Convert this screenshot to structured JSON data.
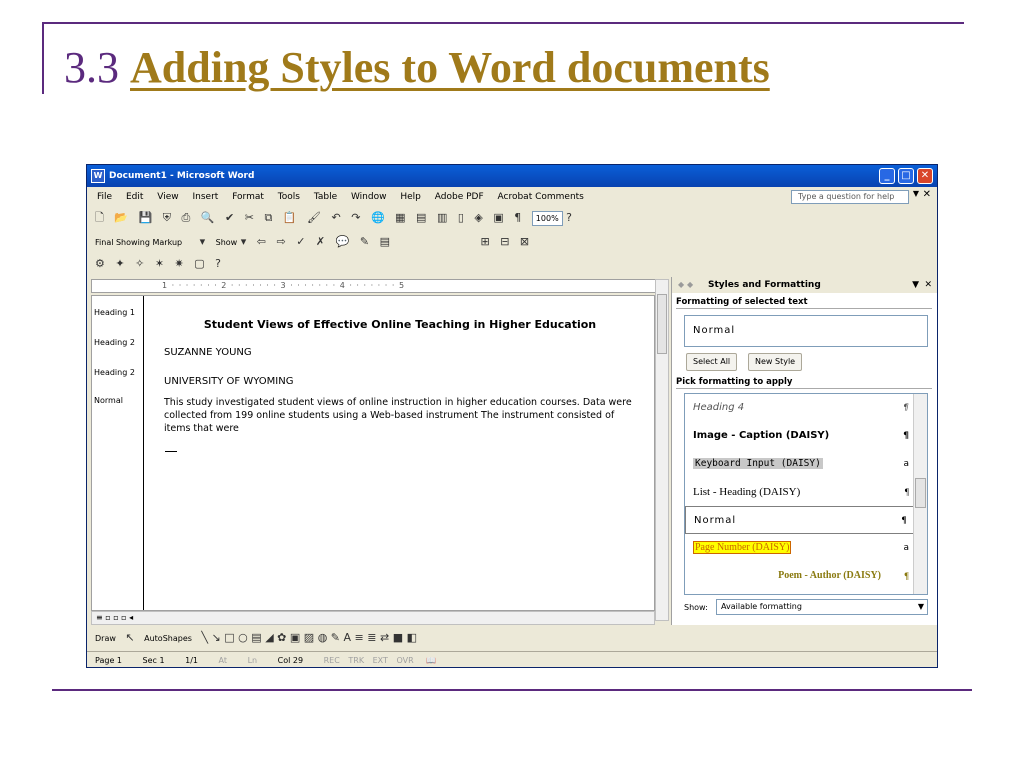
{
  "slide": {
    "title_number": "3.3",
    "title_text": "Adding Styles to Word documents"
  },
  "window": {
    "title": "Document1 - Microsoft Word",
    "minimize": "_",
    "maximize": "□",
    "close": "✕"
  },
  "menu": {
    "items": [
      "File",
      "Edit",
      "View",
      "Insert",
      "Format",
      "Tools",
      "Table",
      "Window",
      "Help",
      "Adobe PDF",
      "Acrobat Comments"
    ],
    "ask_placeholder": "Type a question for help",
    "close": "✕"
  },
  "toolbar1": {
    "zoom": "100%"
  },
  "toolbar2": {
    "markup": "Final Showing Markup",
    "show": "Show"
  },
  "ruler": {
    "text": "1 · · · · · · · 2 · · · · · · · 3 · · · · · · · 4 · · · · · · · 5"
  },
  "document": {
    "style_labels": [
      "Heading 1",
      "Heading 2",
      "Heading 2",
      "Normal"
    ],
    "title": "Student Views of Effective Online Teaching in Higher Education",
    "author": "SUZANNE YOUNG",
    "affiliation": "UNIVERSITY OF WYOMING",
    "paragraph": "This study investigated student views of online instruction in higher education courses. Data were collected from 199 online students using a Web-based instrument The instrument consisted of items that were"
  },
  "drawbar": {
    "draw": "Draw",
    "autoshapes": "AutoShapes"
  },
  "status": {
    "page": "Page 1",
    "sec": "Sec 1",
    "pages": "1/1",
    "at": "At",
    "ln": "Ln",
    "col": "Col 29",
    "rec": "REC",
    "trk": "TRK",
    "ext": "EXT",
    "ovr": "OVR"
  },
  "pane": {
    "title": "Styles and Formatting",
    "selected_heading": "Formatting of selected text",
    "selected_value": "Normal",
    "select_all": "Select All",
    "new_style": "New Style",
    "pick_heading": "Pick formatting to apply",
    "styles": [
      {
        "label": "Heading 4",
        "mark": "¶"
      },
      {
        "label": "Image - Caption (DAISY)",
        "mark": "¶"
      },
      {
        "label": "Keyboard Input (DAISY)",
        "mark": "a"
      },
      {
        "label": "List - Heading (DAISY)",
        "mark": "¶"
      },
      {
        "label": "Normal",
        "mark": "¶"
      },
      {
        "label": "Page Number (DAISY)",
        "mark": "a"
      },
      {
        "label": "Poem - Author (DAISY)",
        "mark": "¶"
      }
    ],
    "show_label": "Show:",
    "show_value": "Available formatting"
  },
  "colors": {
    "title_purple": "#5b2a7e",
    "title_gold": "#a07a1a",
    "xp_blue": "#0a5fd8"
  }
}
